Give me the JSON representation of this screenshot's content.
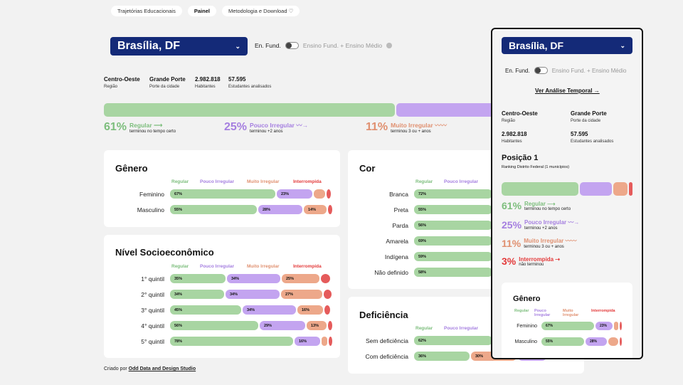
{
  "nav": {
    "tabs": [
      "Trajetórias Educacionais",
      "Painel",
      "Metodologia e Download ♡"
    ]
  },
  "city": {
    "name": "Brasília, DF"
  },
  "toggle": {
    "left": "En. Fund.",
    "right": "Ensino Fund. + Ensino Médio"
  },
  "stats": {
    "regiao": "Centro-Oeste",
    "regiao_lbl": "Região",
    "porte": "Grande Porte",
    "porte_lbl": "Porte da cidade",
    "hab": "2.982.818",
    "hab_lbl": "Habitantes",
    "est": "57.595",
    "est_lbl": "Estudantes analisados"
  },
  "summary": {
    "regular": {
      "pct": "61%",
      "label": "Regular",
      "sub": "terminou no tempo certo"
    },
    "pouco": {
      "pct": "25%",
      "label": "Pouco Irregular",
      "sub": "terminou +2 anos"
    },
    "muito": {
      "pct": "11%",
      "label": "Muito Irregular",
      "sub": "terminou 3 ou + anos"
    },
    "interrompida": {
      "pct": "3%",
      "label": "Interrompida",
      "sub": "não terminou"
    }
  },
  "legend": {
    "regular": "Regular",
    "pouco": "Pouco Irregular",
    "muito": "Muito Irregular",
    "interrompida": "Interrompida"
  },
  "genero": {
    "title": "Gênero",
    "rows": [
      {
        "label": "Feminino",
        "r": "67%",
        "p": "23%",
        "m": ""
      },
      {
        "label": "Masculino",
        "r": "55%",
        "p": "28%",
        "m": "14%"
      }
    ]
  },
  "nse": {
    "title": "Nível Socioeconômico",
    "rows": [
      {
        "label": "1° quintil",
        "r": "35%",
        "p": "34%",
        "m": "25%"
      },
      {
        "label": "2° quintil",
        "r": "34%",
        "p": "34%",
        "m": "27%"
      },
      {
        "label": "3° quintil",
        "r": "45%",
        "p": "34%",
        "m": "16%"
      },
      {
        "label": "4° quintil",
        "r": "56%",
        "p": "29%",
        "m": "13%"
      },
      {
        "label": "5° quintil",
        "r": "78%",
        "p": "16%",
        "m": ""
      }
    ]
  },
  "cor": {
    "title": "Cor",
    "rows": [
      {
        "label": "Branca",
        "r": "72%"
      },
      {
        "label": "Preta",
        "r": "55%"
      },
      {
        "label": "Parda",
        "r": "56%"
      },
      {
        "label": "Amarela",
        "r": "69%"
      },
      {
        "label": "Indígena",
        "r": "59%"
      },
      {
        "label": "Não definido",
        "r": "58%"
      }
    ]
  },
  "deficiencia": {
    "title": "Deficiência",
    "rows": [
      {
        "label": "Sem deficiência",
        "r": "62%"
      },
      {
        "label": "Com deficiência",
        "r": "36%",
        "m": "30%"
      }
    ]
  },
  "panel": {
    "city": "Brasília, DF",
    "link": "Ver Análise Temporal →",
    "posicao": "Posição 1",
    "ranking": "Ranking Distrito Federal (1 municípios)",
    "genero_title": "Gênero",
    "rows": [
      {
        "label": "Feminino",
        "r": "67%",
        "p": "23%"
      },
      {
        "label": "Masculino",
        "r": "55%",
        "p": "28%"
      }
    ]
  },
  "footer": {
    "prefix": "Criado por",
    "link": "Odd Data and Design Studio"
  }
}
